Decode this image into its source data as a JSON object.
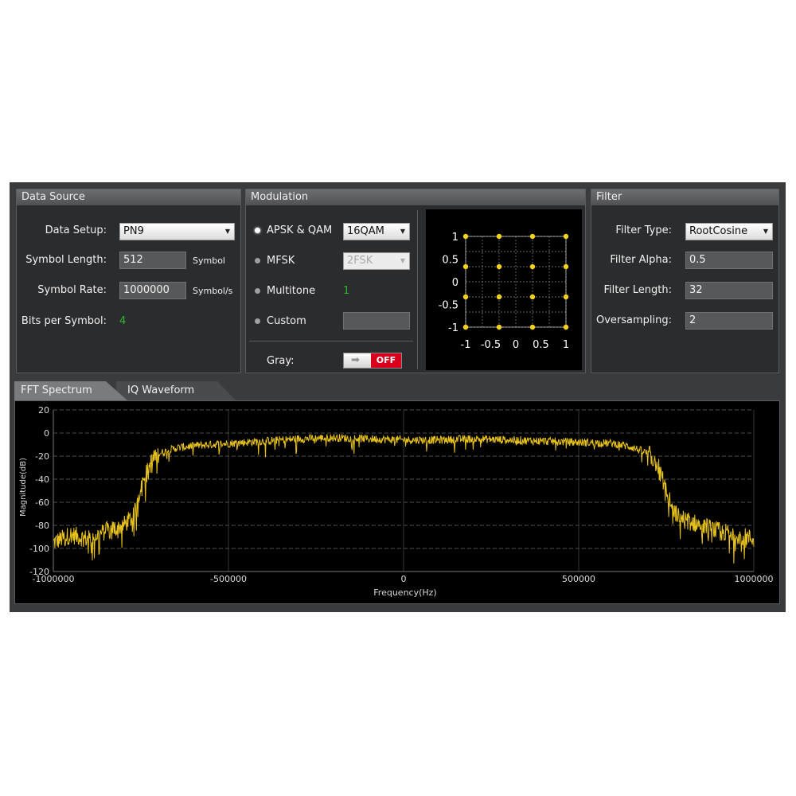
{
  "data_source": {
    "title": "Data Source",
    "data_setup_label": "Data Setup:",
    "data_setup_value": "PN9",
    "symbol_length_label": "Symbol Length:",
    "symbol_length_value": "512",
    "symbol_length_unit": "Symbol",
    "symbol_rate_label": "Symbol Rate:",
    "symbol_rate_value": "1000000",
    "symbol_rate_unit": "Symbol/s",
    "bits_label": "Bits per Symbol:",
    "bits_value": "4"
  },
  "modulation": {
    "title": "Modulation",
    "apsk_label": "APSK & QAM",
    "apsk_value": "16QAM",
    "mfsk_label": "MFSK",
    "mfsk_value": "2FSK",
    "multitone_label": "Multitone",
    "multitone_value": "1",
    "custom_label": "Custom",
    "custom_value": "",
    "gray_label": "Gray:",
    "gray_state": "OFF",
    "selected": "APSK & QAM"
  },
  "filter": {
    "title": "Filter",
    "type_label": "Filter Type:",
    "type_value": "RootCosine",
    "alpha_label": "Filter Alpha:",
    "alpha_value": "0.5",
    "length_label": "Filter Length:",
    "length_value": "32",
    "oversampling_label": "Oversampling:",
    "oversampling_value": "2"
  },
  "tabs": [
    {
      "label": "FFT Spectrum",
      "active": true
    },
    {
      "label": "IQ Waveform",
      "active": false
    }
  ],
  "colors": {
    "trace": "#e8c21c",
    "point": "#f2d21a",
    "off": "#d9001b"
  },
  "chart_data": [
    {
      "type": "scatter",
      "title": "",
      "xlabel": "",
      "ylabel": "",
      "x_ticks": [
        "-1",
        "-0.5",
        "0",
        "0.5",
        "1"
      ],
      "y_ticks": [
        "1",
        "0.5",
        "0",
        "-0.5",
        "-1"
      ],
      "xlim": [
        -1,
        1
      ],
      "ylim": [
        -1,
        1
      ],
      "grid": true,
      "series": [
        {
          "points": [
            [
              -1,
              1
            ],
            [
              -0.333,
              1
            ],
            [
              0.333,
              1
            ],
            [
              1,
              1
            ],
            [
              -1,
              0.333
            ],
            [
              -0.333,
              0.333
            ],
            [
              0.333,
              0.333
            ],
            [
              1,
              0.333
            ],
            [
              -1,
              -0.333
            ],
            [
              -0.333,
              -0.333
            ],
            [
              0.333,
              -0.333
            ],
            [
              1,
              -0.333
            ],
            [
              -1,
              -1
            ],
            [
              -0.333,
              -1
            ],
            [
              0.333,
              -1
            ],
            [
              1,
              -1
            ]
          ]
        }
      ]
    },
    {
      "type": "line",
      "title": "",
      "xlabel": "Frequency(Hz)",
      "ylabel": "Magnitude(dB)",
      "xlim": [
        -1000000,
        1000000
      ],
      "ylim": [
        -120,
        20
      ],
      "x_ticks": [
        "-1000000",
        "-500000",
        "0",
        "500000",
        "1000000"
      ],
      "y_ticks": [
        "20",
        "0",
        "-20",
        "-40",
        "-60",
        "-80",
        "-100",
        "-120"
      ],
      "grid": true,
      "series": [
        {
          "points": [
            [
              -1000000,
              -95
            ],
            [
              -950000,
              -88
            ],
            [
              -900000,
              -92
            ],
            [
              -850000,
              -85
            ],
            [
              -800000,
              -80
            ],
            [
              -770000,
              -72
            ],
            [
              -750000,
              -45
            ],
            [
              -720000,
              -25
            ],
            [
              -700000,
              -18
            ],
            [
              -650000,
              -13
            ],
            [
              -600000,
              -11
            ],
            [
              -500000,
              -9
            ],
            [
              -400000,
              -7
            ],
            [
              -300000,
              -5
            ],
            [
              -200000,
              -4
            ],
            [
              -100000,
              -5
            ],
            [
              0,
              -6
            ],
            [
              100000,
              -6
            ],
            [
              200000,
              -5
            ],
            [
              300000,
              -6
            ],
            [
              400000,
              -7
            ],
            [
              500000,
              -8
            ],
            [
              600000,
              -9
            ],
            [
              650000,
              -12
            ],
            [
              700000,
              -18
            ],
            [
              730000,
              -30
            ],
            [
              750000,
              -50
            ],
            [
              770000,
              -68
            ],
            [
              800000,
              -75
            ],
            [
              850000,
              -80
            ],
            [
              900000,
              -85
            ],
            [
              950000,
              -88
            ],
            [
              1000000,
              -92
            ]
          ]
        }
      ]
    }
  ]
}
